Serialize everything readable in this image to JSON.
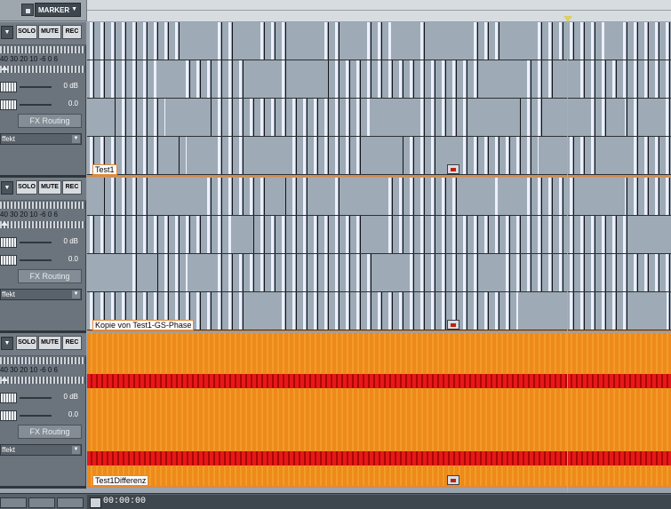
{
  "toolbar": {
    "marker_label": "MARKER"
  },
  "tracks": [
    {
      "clip_name": "Test1",
      "solo": "SOLO",
      "mute": "MUTE",
      "rec": "REC",
      "meter_scale": "40 30 20 10 -6  0  6",
      "volume": "0 dB",
      "pan": "0.0",
      "fx_routing": "FX Routing",
      "effekt": "ffekt",
      "style": "blue"
    },
    {
      "clip_name": "Kopie von Test1-GS-Phase",
      "solo": "SOLO",
      "mute": "MUTE",
      "rec": "REC",
      "meter_scale": "40 30 20 10 -6  0  6",
      "volume": "0 dB",
      "pan": "0.0",
      "fx_routing": "FX Routing",
      "effekt": "ffekt",
      "style": "blue"
    },
    {
      "clip_name": "Test1Differenz",
      "solo": "SOLO",
      "mute": "MUTE",
      "rec": "REC",
      "meter_scale": "40 30 20 10 -6  0  6",
      "volume": "0 dB",
      "pan": "0.0",
      "fx_routing": "FX Routing",
      "effekt": "ffekt",
      "style": "orange"
    }
  ],
  "status": {
    "timecode": "00:00:00"
  },
  "icons": {
    "lock": "lock-icon",
    "dropdown": "chevron-down-icon",
    "playhead": "playhead-marker-icon",
    "clip_fade": "clip-fade-icon"
  },
  "colors": {
    "waveform_bg": "#9eaab6",
    "waveform_lines": "#ecf0ff",
    "difference_orange": "#ec8a1a",
    "difference_red": "#e81818",
    "separator": "#e0893a"
  }
}
